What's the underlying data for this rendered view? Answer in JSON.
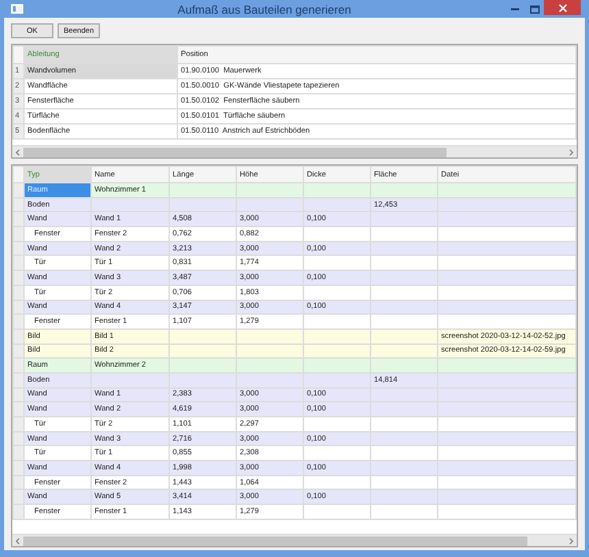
{
  "window": {
    "title": "Aufmaß aus Bauteilen generieren"
  },
  "buttons": [
    {
      "label": "OK"
    },
    {
      "label": "Beenden"
    }
  ],
  "top_table": {
    "columns": [
      {
        "label": "Ableitung",
        "selected": true
      },
      {
        "label": "Position",
        "selected": false
      }
    ],
    "rows": [
      {
        "number": "1",
        "ableitung": "Wandvolumen",
        "position": "01.90.0100  Mauerwerk",
        "selected": true
      },
      {
        "number": "2",
        "ableitung": "Wandfläche",
        "position": "01.50.0010  GK-Wände Vliestapete tapezieren",
        "selected": false
      },
      {
        "number": "3",
        "ableitung": "Fensterfläche",
        "position": "01.50.0102  Fensterfläche säubern",
        "selected": false
      },
      {
        "number": "4",
        "ableitung": "Türfläche",
        "position": "01.50.0101  Türfläche säubern",
        "selected": false
      },
      {
        "number": "5",
        "ableitung": "Bodenfläche",
        "position": "01.50.0110  Anstrich auf Estrichböden",
        "selected": false
      }
    ]
  },
  "bottom_table": {
    "columns": [
      {
        "label": "Typ",
        "selected": true
      },
      {
        "label": "Name",
        "selected": false
      },
      {
        "label": "Länge",
        "selected": false
      },
      {
        "label": "Höhe",
        "selected": false
      },
      {
        "label": "Dicke",
        "selected": false
      },
      {
        "label": "Fläche",
        "selected": false
      },
      {
        "label": "Datei",
        "selected": false
      }
    ],
    "rows": [
      {
        "kind": "raum",
        "selected": true,
        "typ": "Raum",
        "name": "Wohnzimmer 1"
      },
      {
        "kind": "boden",
        "selected": false,
        "typ": "Boden",
        "flaeche": "12,453"
      },
      {
        "kind": "wand",
        "selected": false,
        "typ": "Wand",
        "name": "Wand 1",
        "laenge": "4,508",
        "hoehe": "3,000",
        "dicke": "0,100"
      },
      {
        "kind": "opening",
        "selected": false,
        "typ": "Fenster",
        "name": "Fenster 2",
        "laenge": "0,762",
        "hoehe": "0,882"
      },
      {
        "kind": "wand",
        "selected": false,
        "typ": "Wand",
        "name": "Wand 2",
        "laenge": "3,213",
        "hoehe": "3,000",
        "dicke": "0,100"
      },
      {
        "kind": "opening",
        "selected": false,
        "typ": "Tür",
        "name": "Tür 1",
        "laenge": "0,831",
        "hoehe": "1,774"
      },
      {
        "kind": "wand",
        "selected": false,
        "typ": "Wand",
        "name": "Wand 3",
        "laenge": "3,487",
        "hoehe": "3,000",
        "dicke": "0,100"
      },
      {
        "kind": "opening",
        "selected": false,
        "typ": "Tür",
        "name": "Tür 2",
        "laenge": "0,706",
        "hoehe": "1,803"
      },
      {
        "kind": "wand",
        "selected": false,
        "typ": "Wand",
        "name": "Wand 4",
        "laenge": "3,147",
        "hoehe": "3,000",
        "dicke": "0,100"
      },
      {
        "kind": "opening",
        "selected": false,
        "typ": "Fenster",
        "name": "Fenster 1",
        "laenge": "1,107",
        "hoehe": "1,279"
      },
      {
        "kind": "bild",
        "selected": false,
        "typ": "Bild",
        "name": "Bild 1",
        "datei": "screenshot 2020-03-12-14-02-52.jpg"
      },
      {
        "kind": "bild",
        "selected": false,
        "typ": "Bild",
        "name": "Bild 2",
        "datei": "screenshot 2020-03-12-14-02-59.jpg"
      },
      {
        "kind": "raum",
        "selected": false,
        "typ": "Raum",
        "name": "Wohnzimmer 2"
      },
      {
        "kind": "boden",
        "selected": false,
        "typ": "Boden",
        "flaeche": "14,814"
      },
      {
        "kind": "wand",
        "selected": false,
        "typ": "Wand",
        "name": "Wand 1",
        "laenge": "2,383",
        "hoehe": "3,000",
        "dicke": "0,100"
      },
      {
        "kind": "wand",
        "selected": false,
        "typ": "Wand",
        "name": "Wand 2",
        "laenge": "4,619",
        "hoehe": "3,000",
        "dicke": "0,100"
      },
      {
        "kind": "opening",
        "selected": false,
        "typ": "Tür",
        "name": "Tür 2",
        "laenge": "1,101",
        "hoehe": "2,297"
      },
      {
        "kind": "wand",
        "selected": false,
        "typ": "Wand",
        "name": "Wand 3",
        "laenge": "2,716",
        "hoehe": "3,000",
        "dicke": "0,100"
      },
      {
        "kind": "opening",
        "selected": false,
        "typ": "Tür",
        "name": "Tür 1",
        "laenge": "0,855",
        "hoehe": "2,308"
      },
      {
        "kind": "wand",
        "selected": false,
        "typ": "Wand",
        "name": "Wand 4",
        "laenge": "1,998",
        "hoehe": "3,000",
        "dicke": "0,100"
      },
      {
        "kind": "opening",
        "selected": false,
        "typ": "Fenster",
        "name": "Fenster 2",
        "laenge": "1,443",
        "hoehe": "1,064"
      },
      {
        "kind": "wand",
        "selected": false,
        "typ": "Wand",
        "name": "Wand 5",
        "laenge": "3,414",
        "hoehe": "3,000",
        "dicke": "0,100"
      },
      {
        "kind": "opening",
        "selected": false,
        "typ": "Fenster",
        "name": "Fenster 1",
        "laenge": "1,143",
        "hoehe": "1,279"
      }
    ]
  }
}
